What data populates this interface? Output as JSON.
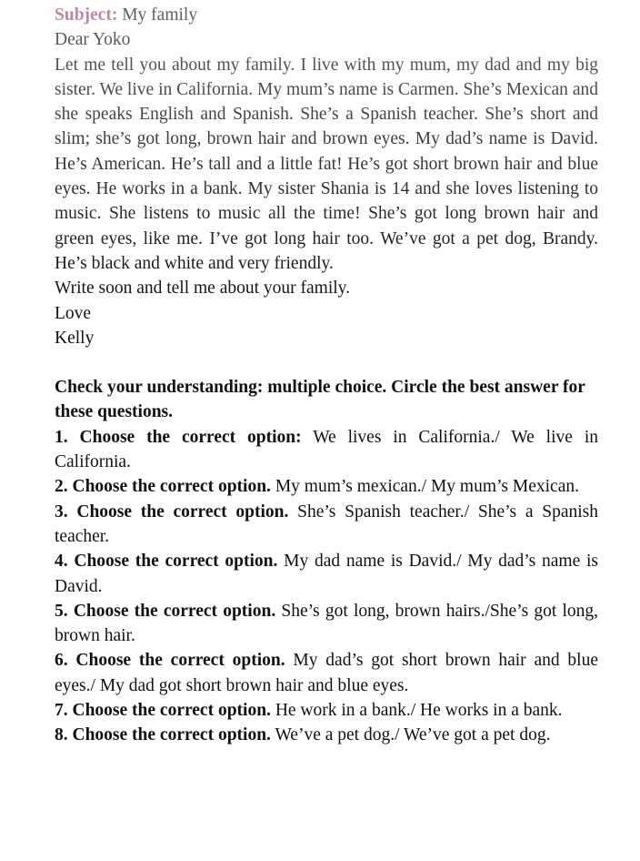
{
  "document": {
    "type": "reading-comprehension-worksheet",
    "accent_color": "#9c4f7c",
    "text_color": "#111111",
    "background_color": "#ffffff"
  },
  "letter": {
    "subject_label": "Subject:",
    "subject_value": "My family",
    "salutation": "Dear Yoko",
    "body": "Let me tell you about my family. I live with my mum, my dad and my big sister. We live in California. My mum’s name is Carmen. She’s Mexican and she speaks English and Spanish. She’s a Spanish teacher. She’s short and slim; she’s got long, brown hair and brown eyes. My dad’s name is David. He’s American. He’s tall and a little fat! He’s got short brown hair and blue eyes. He works in a bank. My sister Shania is 14 and she loves listening to music. She listens to music all the time! She’s got long brown hair and green eyes, like me. I’ve got long hair too. We’ve got a pet dog, Brandy. He’s black and white and very friendly.",
    "closing_request": "Write soon and tell me about your family.",
    "signoff": "Love",
    "signature": "Kelly"
  },
  "exercise": {
    "heading": "Check your understanding: multiple choice. Circle the best answer for these questions.",
    "questions": [
      {
        "number": "1.",
        "stem": "1. Choose the correct option:",
        "options": " We lives in California./ We live in California."
      },
      {
        "number": "2.",
        "stem": "2. Choose the correct option.",
        "options": " My mum’s mexican./ My mum’s Mexican."
      },
      {
        "number": "3.",
        "stem": "3. Choose the correct option.",
        "options": " She’s Spanish teacher./ She’s a Spanish teacher."
      },
      {
        "number": "4.",
        "stem": "4. Choose the correct option.",
        "options": " My dad name is David./ My dad’s name is David."
      },
      {
        "number": "5.",
        "stem": "5. Choose the correct option.",
        "options": " She’s got long, brown hairs./She’s got long, brown hair."
      },
      {
        "number": "6.",
        "stem": "6. Choose the correct option.",
        "options": " My dad’s got short brown hair and blue eyes./ My dad got short brown hair and blue eyes."
      },
      {
        "number": "7.",
        "stem": "7. Choose the correct option.",
        "options": " He work in a bank./ He works in a bank."
      },
      {
        "number": "8.",
        "stem": "8. Choose the correct option.",
        "options": " We’ve a pet dog./ We’ve got a pet dog."
      }
    ]
  }
}
